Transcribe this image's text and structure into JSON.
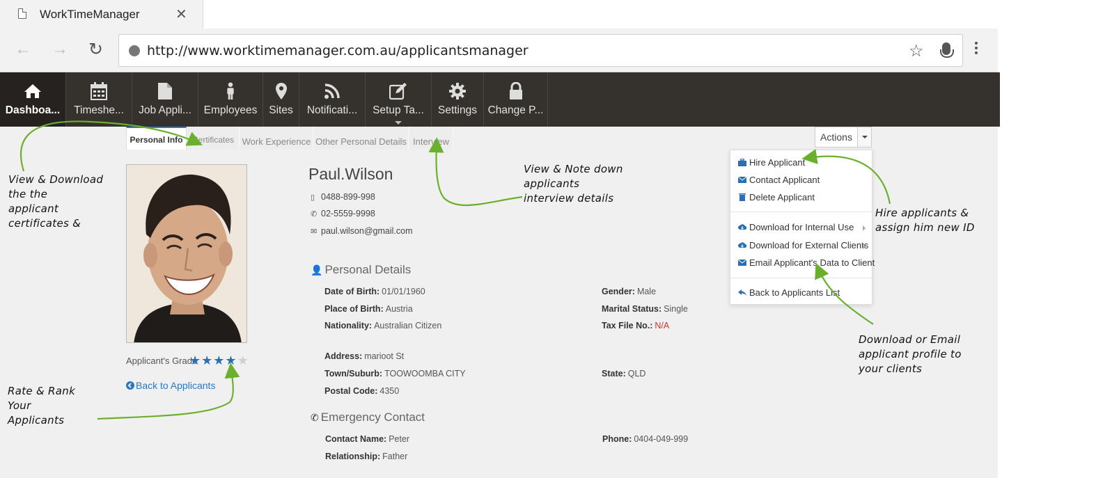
{
  "browser": {
    "tab_title": "WorkTimeManager",
    "tab_close": "✕",
    "url": "http://www.worktimemanager.com.au/applicantsmanager",
    "back": "←",
    "forward": "→",
    "reload": "↻",
    "bookmark": "☆"
  },
  "nav": {
    "items": [
      {
        "label": "Dashboa...",
        "icon": "home-icon"
      },
      {
        "label": "Timeshe...",
        "icon": "calendar-icon"
      },
      {
        "label": "Job Appli...",
        "icon": "document-icon"
      },
      {
        "label": "Employees",
        "icon": "person-icon"
      },
      {
        "label": "Sites",
        "icon": "map-marker-icon"
      },
      {
        "label": "Notificati...",
        "icon": "rss-icon"
      },
      {
        "label": "Setup Ta...",
        "icon": "edit-icon"
      },
      {
        "label": "Settings",
        "icon": "gear-icon"
      },
      {
        "label": "Change P...",
        "icon": "lock-icon"
      }
    ]
  },
  "profile_tabs": [
    "Personal Info",
    "Certificates",
    "Work Experience",
    "Other Personal Details",
    "Interview"
  ],
  "actions": {
    "label": "Actions",
    "items": [
      {
        "label": "Hire Applicant",
        "icon": "briefcase-icon"
      },
      {
        "label": "Contact Applicant",
        "icon": "envelope-icon"
      },
      {
        "label": "Delete Applicant",
        "icon": "trash-icon"
      },
      {
        "label": "Download for Internal Use",
        "icon": "cloud-download-icon"
      },
      {
        "label": "Download for External Clients",
        "icon": "cloud-download-icon"
      },
      {
        "label": "Email Applicant's Data to Client",
        "icon": "envelope-icon"
      },
      {
        "label": "Back to Applicants List",
        "icon": "reply-icon"
      }
    ]
  },
  "applicant": {
    "name": "Paul.Wilson",
    "mobile": "0488-899-998",
    "phone": "02-5559-9998",
    "email": "paul.wilson@gmail.com",
    "grade_label": "Applicant's Grade",
    "grade": 4,
    "grade_max": 5,
    "back_link": "Back to Applicants"
  },
  "personal": {
    "heading": "Personal Details",
    "dob_label": "Date of Birth:",
    "dob": "01/01/1960",
    "pob_label": "Place of Birth:",
    "pob": "Austria",
    "nationality_label": "Nationality:",
    "nationality": "Australian Citizen",
    "gender_label": "Gender:",
    "gender": "Male",
    "marital_label": "Marital Status:",
    "marital": "Single",
    "tfn_label": "Tax File No.:",
    "tfn": "N/A",
    "address_label": "Address:",
    "address": "marioot St",
    "town_label": "Town/Suburb:",
    "town": "TOOWOOMBA CITY",
    "state_label": "State:",
    "state": "QLD",
    "postcode_label": "Postal Code:",
    "postcode": "4350"
  },
  "emergency": {
    "heading": "Emergency Contact",
    "name_label": "Contact Name:",
    "name": "Peter",
    "relationship_label": "Relationship:",
    "relationship": "Father",
    "phone_label": "Phone:",
    "phone": "0404-049-999"
  },
  "annotations": {
    "certificates": [
      "View & Download",
      "the the",
      "applicant",
      "certificates &"
    ],
    "interview": [
      "View & Note down",
      "applicants",
      "interview details"
    ],
    "hire": [
      "Hire applicants &",
      "assign him new ID"
    ],
    "download": [
      "Download or Email",
      "applicant profile to",
      "your clients"
    ],
    "rate": [
      "Rate & Rank",
      "Your",
      "Applicants"
    ]
  },
  "colors": {
    "nav_bg": "#35312d",
    "accent": "#2a78c0",
    "arrow_green": "#6ab02d",
    "na_red": "#d0312d"
  }
}
